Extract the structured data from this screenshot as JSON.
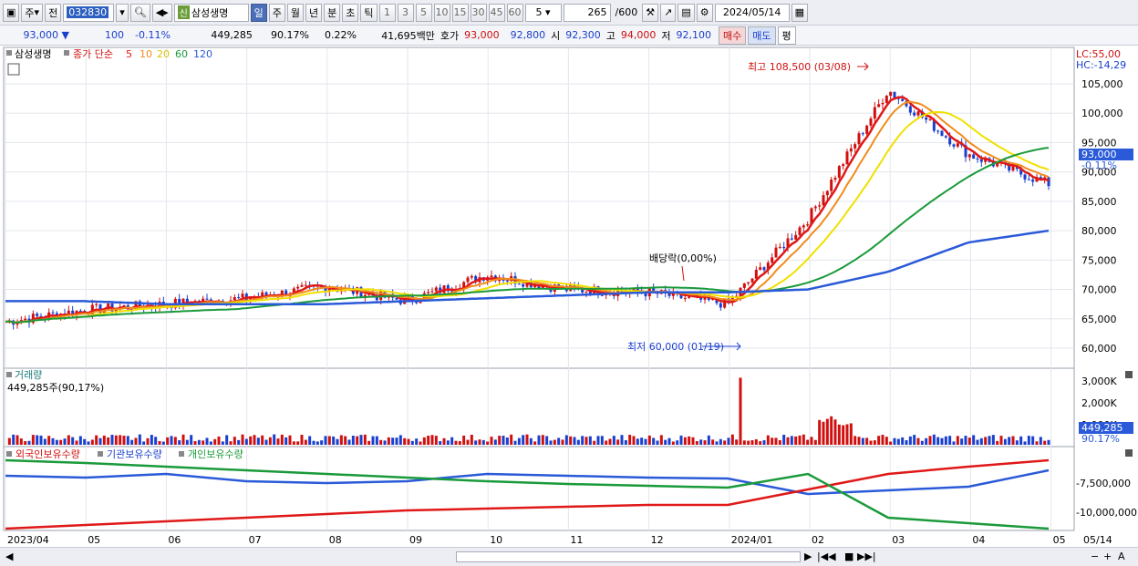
{
  "toolbar": {
    "period_type": "주",
    "prev_label": "전",
    "stock_code": "032830",
    "new_badge": "신",
    "stock_name": "삼성생명",
    "period_tabs": [
      "일",
      "주",
      "월",
      "년",
      "분",
      "초",
      "틱"
    ],
    "active_period": "일",
    "minute_options": [
      "1",
      "3",
      "5",
      "10",
      "15",
      "30",
      "45",
      "60"
    ],
    "interval_value": "5",
    "display_count": "265",
    "display_total": "/600",
    "date": "2024/05/14"
  },
  "quote": {
    "price": "93,000",
    "change": "100",
    "change_pct": "-0.11%",
    "volume": "449,285",
    "volume_ratio": "90.17%",
    "turnover": "0.22%",
    "amount": "41,695백만",
    "bid_ask_label": "호가",
    "ask": "93,000",
    "bid": "92,800",
    "open_label": "시",
    "open": "92,300",
    "high_label": "고",
    "high": "94,000",
    "low_label": "저",
    "low": "92,100",
    "buy_label": "매수",
    "sell_label": "매도",
    "eval_label": "평"
  },
  "price_panel": {
    "title": "삼성생명",
    "ma_label": "종가 단순",
    "ma_periods": [
      "5",
      "10",
      "20",
      "60",
      "120"
    ],
    "lc": "LC:55,00",
    "hc": "HC:-14,29",
    "high_annotation": "최고 108,500 (03/08)",
    "low_annotation": "최저 60,000 (01/19)",
    "dividend_annotation": "배당락(0,00%)",
    "current_price_tag": "93,000",
    "current_change_tag": "-0.11%",
    "y_ticks": [
      "105,000",
      "100,000",
      "95,000",
      "90,000",
      "85,000",
      "80,000",
      "75,000",
      "70,000",
      "65,000",
      "60,000"
    ]
  },
  "volume_panel": {
    "title": "거래량",
    "value_text": "449,285주(90,17%)",
    "y_ticks": [
      "3,000K",
      "2,000K",
      "1,000K"
    ],
    "tag_value": "449,285",
    "tag_pct": "90.17%"
  },
  "holding_panel": {
    "series_labels": [
      "외국인보유수량",
      "기관보유수량",
      "개인보유수량"
    ],
    "y_ticks": [
      "-7,500,000",
      "-10,000,000"
    ]
  },
  "x_axis": [
    "2023/04",
    "05",
    "06",
    "07",
    "08",
    "09",
    "10",
    "11",
    "12",
    "2024/01",
    "02",
    "03",
    "04",
    "05",
    "05/14"
  ],
  "colors": {
    "ma5": "#e01818",
    "ma10": "#f08c1c",
    "ma20": "#f0e000",
    "ma60": "#1a9a3a",
    "ma120": "#2a5ad8",
    "up": "#d01010",
    "down": "#1a3fcf",
    "foreign": "#2a5ad8",
    "institution": "#e01818",
    "individual": "#1a9a3a"
  },
  "chart_data": {
    "type": "line",
    "title": "삼성생명",
    "x": [
      "2023/04",
      "05",
      "06",
      "07",
      "08",
      "09",
      "10",
      "11",
      "12",
      "2024/01",
      "02",
      "03",
      "04",
      "05"
    ],
    "series": [
      {
        "name": "5",
        "values": [
          64500,
          66500,
          67500,
          68500,
          70500,
          68000,
          72500,
          70000,
          69500,
          67500,
          82000,
          104000,
          93000,
          88000
        ]
      },
      {
        "name": "120",
        "values": [
          68000,
          68000,
          67500,
          67500,
          67500,
          68000,
          68500,
          69000,
          69500,
          69500,
          70000,
          73000,
          78000,
          80000
        ]
      }
    ],
    "ylim": [
      58000,
      110000
    ],
    "annotations": [
      "최고 108,500 (03/08)",
      "최저 60,000 (01/19)",
      "배당락(0,00%)"
    ]
  }
}
